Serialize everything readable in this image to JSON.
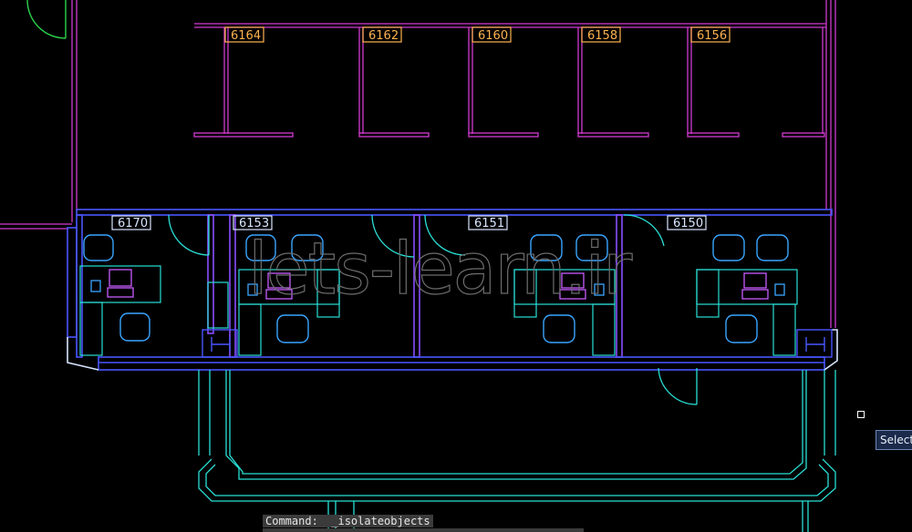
{
  "rooms_top": [
    "6164",
    "6162",
    "6160",
    "6158",
    "6156"
  ],
  "rooms_bottom": [
    "6170",
    "6153",
    "6151",
    "6150"
  ],
  "watermark": "lets-learn.ir",
  "command_line": {
    "text": "Command:  _isolateobjects"
  },
  "tooltip": {
    "text": "Select"
  },
  "colors": {
    "background": "#000000",
    "magenta_walls": "#d23ad2",
    "blue_walls": "#4a56ff",
    "purple_walls": "#8a4dff",
    "cyan_furniture": "#28e0d6",
    "light_blue_furniture": "#3aa6ff",
    "green_door": "#2ad34a",
    "tag_orange": "#ffb34d"
  }
}
